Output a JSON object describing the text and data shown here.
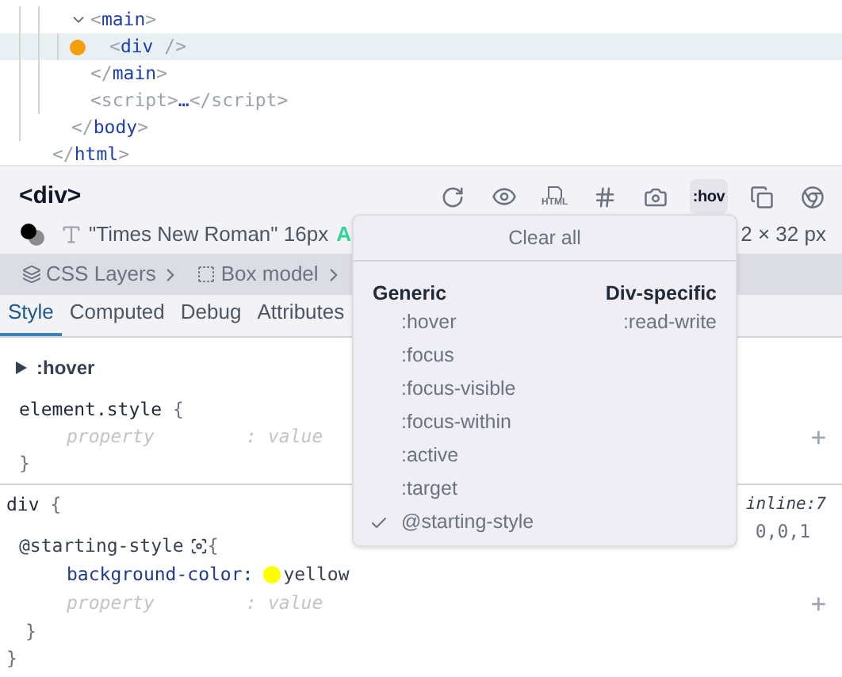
{
  "tree": [
    {
      "kind": "group",
      "children": [
        {
          "kind": "group",
          "children": [
            {
              "kind": "open",
              "expanded": true,
              "parts": [
                {
                  "kind": "punct",
                  "text": "<"
                },
                {
                  "kind": "tag",
                  "text": "main"
                },
                {
                  "kind": "punct",
                  "text": ">"
                }
              ],
              "children": [
                {
                  "kind": "leaf",
                  "selected": true,
                  "marker": true,
                  "parts": [
                    {
                      "kind": "punct",
                      "text": "<"
                    },
                    {
                      "kind": "tag",
                      "text": "div"
                    },
                    {
                      "kind": "punct",
                      "text": " />"
                    }
                  ]
                }
              ]
            },
            {
              "kind": "leaf",
              "selected": false,
              "marker": false,
              "parts": [
                {
                  "kind": "punct",
                  "text": "</"
                },
                {
                  "kind": "tag",
                  "text": "main"
                },
                {
                  "kind": "punct",
                  "text": ">"
                }
              ]
            },
            {
              "kind": "leaf",
              "selected": false,
              "marker": false,
              "parts": [
                {
                  "kind": "punct",
                  "text": "<script>"
                },
                {
                  "kind": "tag",
                  "text": "…"
                },
                {
                  "kind": "punct",
                  "text": "</script>"
                }
              ]
            }
          ]
        },
        {
          "kind": "leaf",
          "selected": false,
          "marker": false,
          "parts": [
            {
              "kind": "punct",
              "text": "</"
            },
            {
              "kind": "tag",
              "text": "body"
            },
            {
              "kind": "punct",
              "text": ">"
            }
          ]
        }
      ]
    },
    {
      "kind": "leaf",
      "selected": false,
      "marker": false,
      "parts": [
        {
          "kind": "punct",
          "text": "</"
        },
        {
          "kind": "tag",
          "text": "html"
        },
        {
          "kind": "punct",
          "text": ">"
        }
      ]
    }
  ],
  "header": {
    "element": "<div>",
    "font": "\"Times New Roman\" 16px",
    "contrast": "A",
    "size": "2 × 32 px"
  },
  "toolbar": [
    {
      "kind": "refresh",
      "selected": false
    },
    {
      "kind": "eye",
      "selected": false
    },
    {
      "kind": "html",
      "label": "HTML",
      "selected": false
    },
    {
      "kind": "hash",
      "selected": false
    },
    {
      "kind": "camera",
      "selected": false
    },
    {
      "kind": "text",
      "label": ":hov",
      "selected": true
    },
    {
      "kind": "copy",
      "selected": false
    },
    {
      "kind": "chrome",
      "selected": false
    }
  ],
  "breadcrumbs": [
    {
      "kind": "layers",
      "label": "CSS Layers"
    },
    {
      "kind": "box",
      "label": "Box model"
    }
  ],
  "tabs": [
    {
      "label": "Style",
      "selected": true
    },
    {
      "label": "Computed",
      "selected": false
    },
    {
      "label": "Debug",
      "selected": false
    },
    {
      "label": "Attributes",
      "selected": false
    }
  ],
  "hover_section": {
    "label": ":hover",
    "expanded": false
  },
  "rules": [
    {
      "selector": "element.style",
      "brace": "{",
      "close": "}",
      "add": "+",
      "declarations": [
        {
          "kind": "placeholder",
          "property": "property",
          "sep": ":",
          "value": "value"
        }
      ]
    },
    {
      "selector": "div",
      "brace": "{",
      "close": "}",
      "source": "inline:7",
      "specificity": "0,0,1",
      "at_rule": {
        "name": "@starting-style",
        "brace": "{",
        "close": "}",
        "add": "+",
        "declarations": [
          {
            "kind": "declaration",
            "property": "background-color:",
            "color": "#ffff00",
            "value": "yellow"
          },
          {
            "kind": "placeholder",
            "property": "property",
            "sep": ":",
            "value": "value"
          }
        ]
      }
    }
  ],
  "pseudo_menu": {
    "clear": "Clear all",
    "groups": [
      {
        "title": "Generic",
        "items": [
          {
            "label": ":hover",
            "checked": false
          },
          {
            "label": ":focus",
            "checked": false
          },
          {
            "label": ":focus-visible",
            "checked": false
          },
          {
            "label": ":focus-within",
            "checked": false
          },
          {
            "label": ":active",
            "checked": false
          },
          {
            "label": ":target",
            "checked": false
          },
          {
            "label": "@starting-style",
            "checked": true
          }
        ]
      },
      {
        "title": "Div-specific",
        "items": [
          {
            "label": ":read-write",
            "checked": false
          }
        ]
      }
    ]
  }
}
